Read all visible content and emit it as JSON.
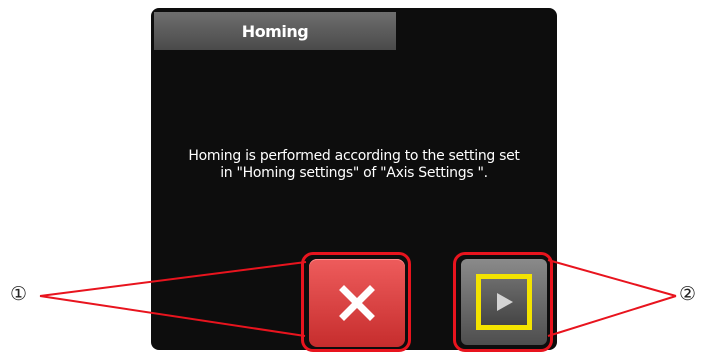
{
  "dialog": {
    "title": "Homing",
    "message_lines": [
      "Homing is performed according to the setting set",
      "in \"Homing settings\" of \"Axis Settings \"."
    ]
  },
  "buttons": {
    "cancel_icon": "close-x-icon",
    "start_icon": "play-triangle-icon"
  },
  "callouts": {
    "one": "①",
    "two": "②"
  },
  "colors": {
    "cancel": "#d83a3a",
    "highlight": "#e8141e",
    "start_border": "#f3e300",
    "panel": "#0d0d0d"
  }
}
